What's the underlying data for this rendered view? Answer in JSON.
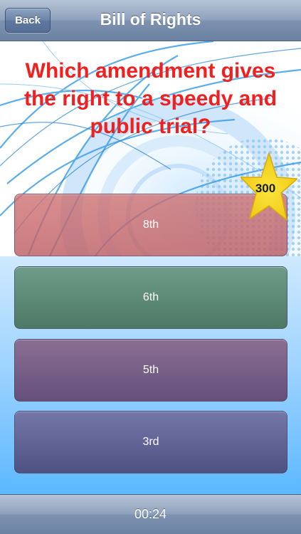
{
  "navbar": {
    "back_label": "Back",
    "title": "Bill of Rights"
  },
  "question": {
    "text": "Which amendment gives the right to a speedy and public trial?"
  },
  "points": "300",
  "answers": [
    {
      "label": "8th"
    },
    {
      "label": "6th"
    },
    {
      "label": "5th"
    },
    {
      "label": "3rd"
    }
  ],
  "timer": "00:24",
  "colors": {
    "question": "#f02020",
    "star": "#f5d81e",
    "answer_1": "#c86c72",
    "answer_2": "#5e8a78",
    "answer_3": "#775f86",
    "answer_4": "#626596"
  }
}
